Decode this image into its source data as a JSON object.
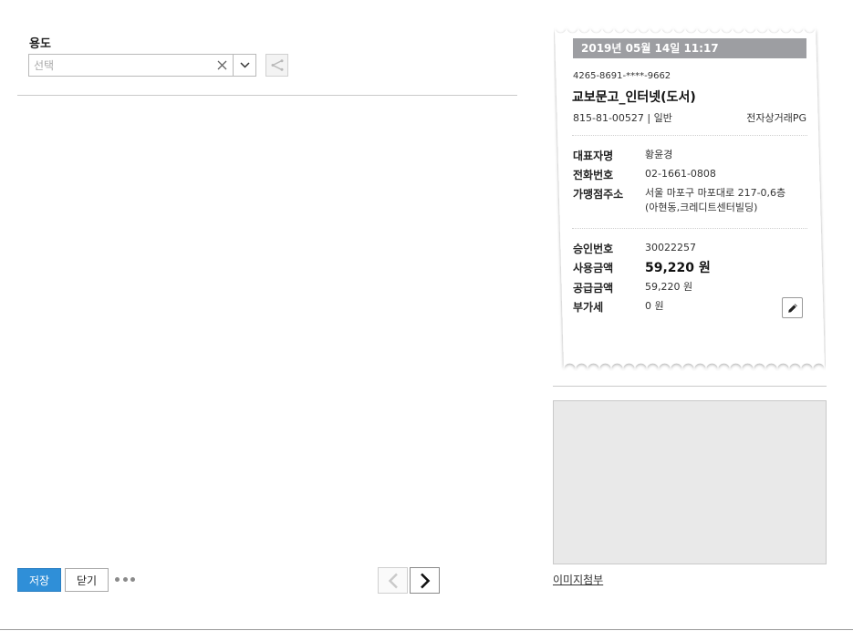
{
  "form": {
    "usage_label": "용도",
    "select_placeholder": "선택",
    "clear_icon": "close-icon",
    "dropdown_icon": "chevron-down-icon",
    "share_icon": "share-icon"
  },
  "actions": {
    "save_label": "저장",
    "close_label": "닫기",
    "more_icon": "more-dots-icon",
    "prev_icon": "chevron-left-icon",
    "next_icon": "chevron-right-icon"
  },
  "receipt": {
    "datetime": "2019년 05월 14일 11:17",
    "card_number": "4265-8691-****-9662",
    "store_name": "교보문고_인터넷(도서)",
    "biz_info": "815-81-00527 | 일반",
    "pg_type": "전자상거래PG",
    "rep_label": "대표자명",
    "rep_value": "황윤경",
    "phone_label": "전화번호",
    "phone_value": "02-1661-0808",
    "addr_label": "가맹점주소",
    "addr_line1": "서울 마포구 마포대로 217-0,6층",
    "addr_line2": "(아현동,크레디트센터빌딩)",
    "approval_label": "승인번호",
    "approval_value": "30022257",
    "amount_label": "사용금액",
    "amount_value": "59,220 원",
    "supply_label": "공급금액",
    "supply_value": "59,220 원",
    "vat_label": "부가세",
    "vat_value": "0 원",
    "edit_icon": "pencil-icon"
  },
  "attachment": {
    "link_label": "이미지첨부"
  },
  "colors": {
    "primary": "#2f8fd8",
    "receipt_header": "#9d9ea2",
    "image_placeholder": "#e9e9e9"
  }
}
